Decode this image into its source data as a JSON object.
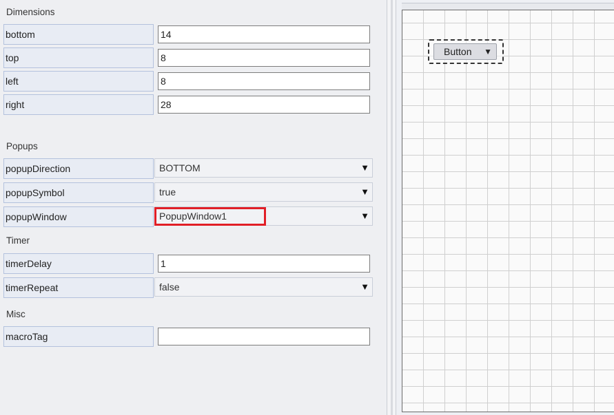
{
  "sections": {
    "dimensions": {
      "title": "Dimensions",
      "rows": [
        {
          "name": "bottom",
          "value": "14"
        },
        {
          "name": "top",
          "value": "8"
        },
        {
          "name": "left",
          "value": "8"
        },
        {
          "name": "right",
          "value": "28"
        }
      ]
    },
    "popups": {
      "title": "Popups",
      "rows": [
        {
          "name": "popupDirection",
          "value": "BOTTOM"
        },
        {
          "name": "popupSymbol",
          "value": "true"
        },
        {
          "name": "popupWindow",
          "value": "PopupWindow1"
        }
      ]
    },
    "timer": {
      "title": "Timer",
      "rows": [
        {
          "name": "timerDelay",
          "value": "1"
        },
        {
          "name": "timerRepeat",
          "value": "false"
        }
      ]
    },
    "misc": {
      "title": "Misc",
      "rows": [
        {
          "name": "macroTag",
          "value": ""
        }
      ]
    }
  },
  "combo_arrow_glyph": "▼",
  "canvas": {
    "button_label": "Button",
    "button_arrow": "▼"
  },
  "colors": {
    "highlight": "#e11e26",
    "name_cell_bg": "#e8ecf4",
    "grid_line": "#cfcfcf"
  }
}
